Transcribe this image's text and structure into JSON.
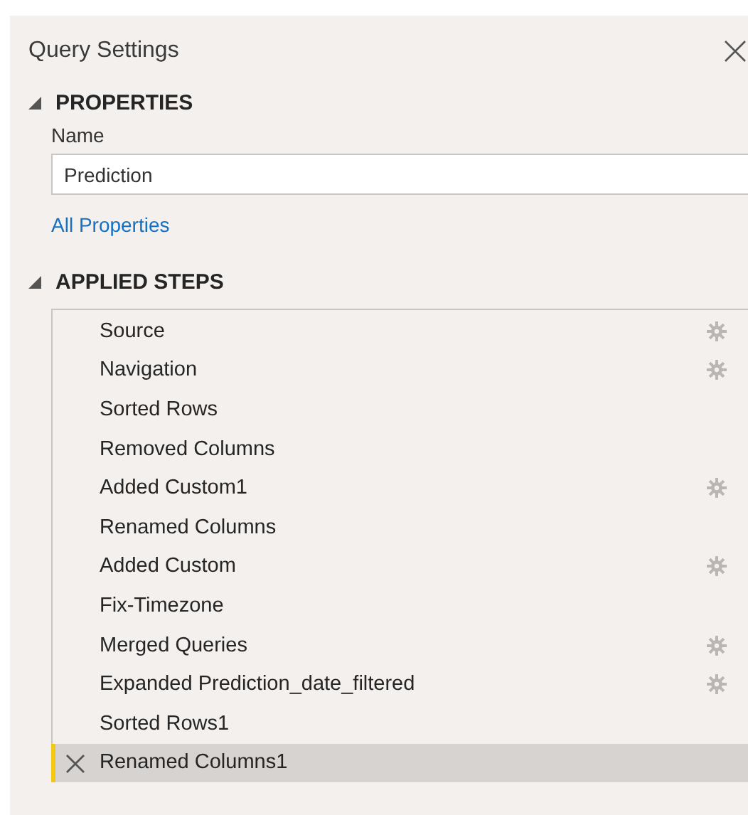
{
  "panel": {
    "title": "Query Settings"
  },
  "properties": {
    "heading": "PROPERTIES",
    "expanded": true,
    "name_label": "Name",
    "name_value": "Prediction",
    "link": "All Properties"
  },
  "applied_steps": {
    "heading": "APPLIED STEPS",
    "expanded": true,
    "steps": [
      {
        "label": "Source",
        "settings": true,
        "selected": false
      },
      {
        "label": "Navigation",
        "settings": true,
        "selected": false
      },
      {
        "label": "Sorted Rows",
        "settings": false,
        "selected": false
      },
      {
        "label": "Removed Columns",
        "settings": false,
        "selected": false
      },
      {
        "label": "Added Custom1",
        "settings": true,
        "selected": false
      },
      {
        "label": "Renamed Columns",
        "settings": false,
        "selected": false
      },
      {
        "label": "Added Custom",
        "settings": true,
        "selected": false
      },
      {
        "label": "Fix-Timezone",
        "settings": false,
        "selected": false
      },
      {
        "label": "Merged Queries",
        "settings": true,
        "selected": false
      },
      {
        "label": "Expanded Prediction_date_filtered",
        "settings": true,
        "selected": false
      },
      {
        "label": "Sorted Rows1",
        "settings": false,
        "selected": false
      },
      {
        "label": "Renamed Columns1",
        "settings": false,
        "selected": true
      }
    ]
  }
}
